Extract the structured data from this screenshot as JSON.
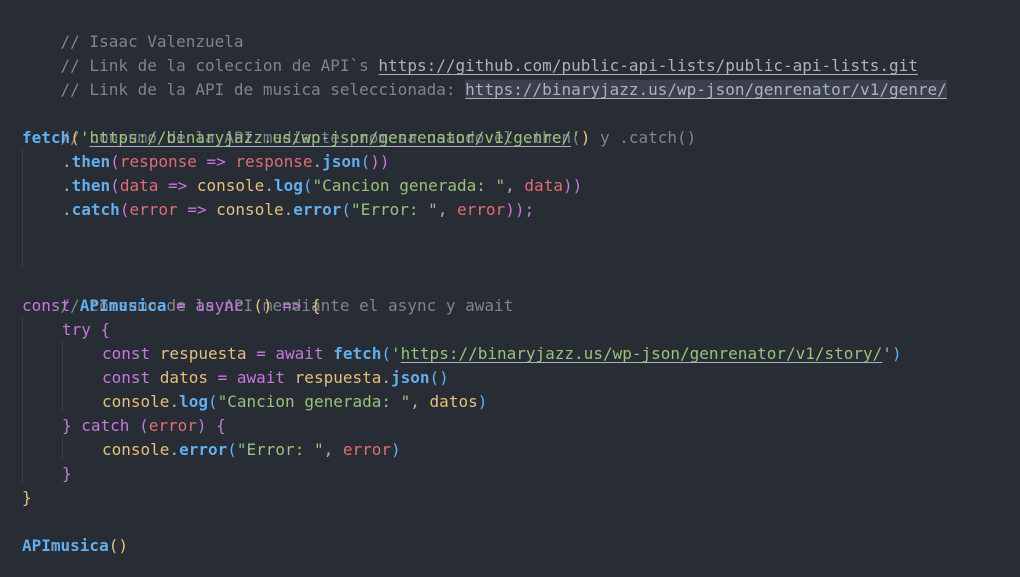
{
  "code_lines": {
    "l1": [
      "// Isaac Valenzuela"
    ],
    "l2": [
      "// Link de la coleccion de API`s ",
      "https://github.com/public-api-lists/public-api-lists.git"
    ],
    "l3": [
      "// Link de la API de musica seleccionada: ",
      "https://binaryjazz.us/wp-json/genrenator/v1/genre/"
    ],
    "l5": [
      "// consumo de la API mediante promesa usando el .then() y .catch()"
    ],
    "l6": [
      "fetch",
      "(",
      "'",
      "https://binaryjazz.us/wp-json/genrenator/v1/genre/",
      "'",
      ")"
    ],
    "l7": [
      ".",
      "then",
      "(",
      "response",
      " => ",
      "response",
      ".",
      "json",
      "(",
      "))"
    ],
    "l8": [
      ".",
      "then",
      "(",
      "data",
      " => ",
      "console",
      ".",
      "log",
      "(",
      "\"Cancion generada: \"",
      ", ",
      "data",
      "))"
    ],
    "l9": [
      ".",
      "catch",
      "(",
      "error",
      " => ",
      "console",
      ".",
      "error",
      "(",
      "\"Error: \"",
      ", ",
      "error",
      "));"
    ],
    "l12": [
      "// consumo de la API mendiante el async y await"
    ],
    "l13": [
      "const ",
      "APImusica",
      " = ",
      "async",
      " ",
      "()",
      " => ",
      "{"
    ],
    "l14": [
      "try",
      " ",
      "{"
    ],
    "l15": [
      "const ",
      "respuesta",
      " = ",
      "await ",
      "fetch",
      "(",
      "'",
      "https://binaryjazz.us/wp-json/genrenator/v1/story/",
      "'",
      ")"
    ],
    "l16": [
      "const ",
      "datos",
      " = ",
      "await ",
      "respuesta",
      ".",
      "json",
      "()"
    ],
    "l17": [
      "console",
      ".",
      "log",
      "(",
      "\"Cancion generada: \"",
      ", ",
      "datos",
      ")"
    ],
    "l18": [
      "}",
      " catch ",
      "(",
      "error",
      ")",
      " {"
    ],
    "l19": [
      "console",
      ".",
      "error",
      "(",
      "\"Error: \"",
      ", ",
      "error",
      ")"
    ],
    "l20": [
      "}"
    ],
    "l21": [
      "}"
    ],
    "l23": [
      "APImusica",
      "()"
    ]
  }
}
